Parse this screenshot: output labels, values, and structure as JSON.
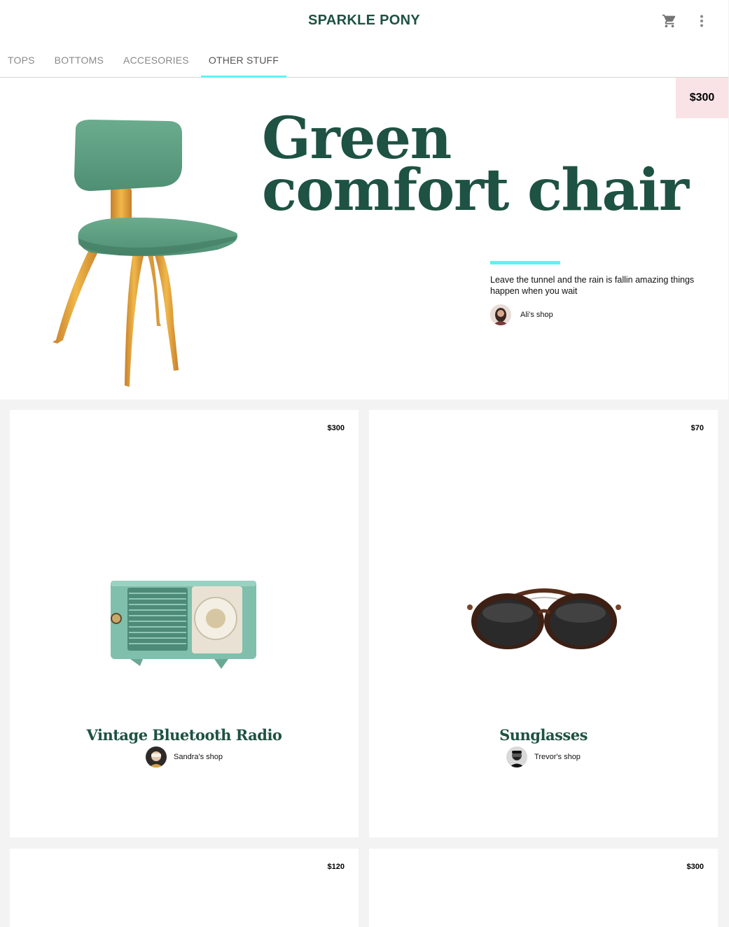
{
  "header": {
    "brand": "SPARKLE PONY",
    "icons": {
      "cart": "shopping-cart-icon",
      "menu": "more-vert-icon"
    },
    "tabs": [
      {
        "label": "TOPS",
        "active": false
      },
      {
        "label": "BOTTOMS",
        "active": false
      },
      {
        "label": "ACCESORIES",
        "active": false
      },
      {
        "label": "OTHER STUFF",
        "active": true
      }
    ]
  },
  "featured": {
    "price": "$300",
    "title": "Green comfort chair",
    "description": "Leave the tunnel and the rain is fallin amazing things happen when you wait",
    "shop": "Ali's shop",
    "image": "green-chair-image"
  },
  "products": [
    {
      "price": "$300",
      "title": "Vintage Bluetooth Radio",
      "shop": "Sandra's shop",
      "image": "vintage-radio-image"
    },
    {
      "price": "$70",
      "title": "Sunglasses",
      "shop": "Trevor's shop",
      "image": "sunglasses-image"
    },
    {
      "price": "$120"
    },
    {
      "price": "$300"
    }
  ],
  "colors": {
    "brand_green": "#1e5243",
    "accent_cyan": "#5ff2f0",
    "price_tag_pink": "#f9e3e6",
    "background": "#f3f3f3"
  }
}
